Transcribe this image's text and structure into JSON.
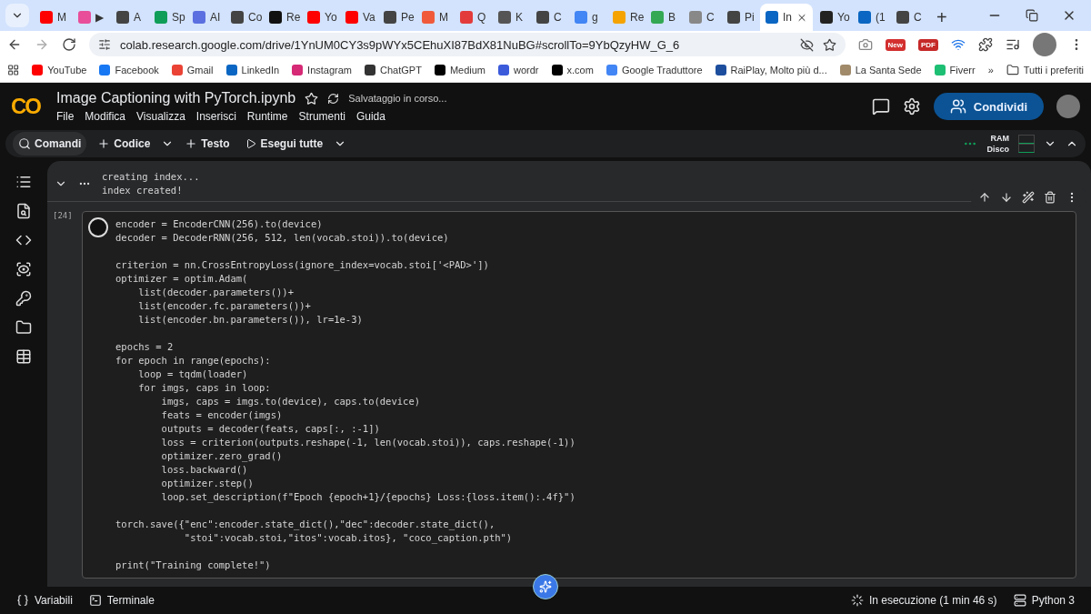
{
  "browser": {
    "tabs": [
      {
        "label": "M",
        "selected": false,
        "color": "#ff0000"
      },
      {
        "label": "▶",
        "selected": false,
        "color": "#e84e9a"
      },
      {
        "label": "A",
        "selected": false,
        "color": "#444444"
      },
      {
        "label": "Sp",
        "selected": false,
        "color": "#0f9d58"
      },
      {
        "label": "AI",
        "selected": false,
        "color": "#5b6fe0"
      },
      {
        "label": "Co",
        "selected": false,
        "color": "#444444"
      },
      {
        "label": "Re",
        "selected": false,
        "color": "#111111"
      },
      {
        "label": "Yo",
        "selected": false,
        "color": "#ff0000"
      },
      {
        "label": "Va",
        "selected": false,
        "color": "#ff0000"
      },
      {
        "label": "Pe",
        "selected": false,
        "color": "#444444"
      },
      {
        "label": "M",
        "selected": false,
        "color": "#f05a3a"
      },
      {
        "label": "Q",
        "selected": false,
        "color": "#e33b3b"
      },
      {
        "label": "K",
        "selected": false,
        "color": "#555555"
      },
      {
        "label": "C",
        "selected": false,
        "color": "#444444"
      },
      {
        "label": "g",
        "selected": false,
        "color": "#4285f4"
      },
      {
        "label": "Re",
        "selected": false,
        "color": "#f4a300"
      },
      {
        "label": "B",
        "selected": false,
        "color": "#34a853"
      },
      {
        "label": "C",
        "selected": false,
        "color": "#888888"
      },
      {
        "label": "Pi",
        "selected": false,
        "color": "#444444"
      },
      {
        "label": "In",
        "selected": true,
        "color": "#0a66c2"
      },
      {
        "label": "Yo",
        "selected": false,
        "color": "#222222"
      },
      {
        "label": "(1",
        "selected": false,
        "color": "#0a66c2"
      },
      {
        "label": "C",
        "selected": false,
        "color": "#444444"
      }
    ],
    "new_tab": "+",
    "url": "colab.research.google.com/drive/1YnUM0CY3s9pWYx5CEhuXI87BdX81NuBG#scrollTo=9YbQzyHW_G_6",
    "extension_badges": [
      {
        "label": "New",
        "color": "#d32f2f"
      },
      {
        "label": "PDF",
        "color": "#c62828"
      }
    ],
    "bookmarks": [
      {
        "label": "YouTube",
        "color": "#ff0000"
      },
      {
        "label": "Facebook",
        "color": "#1877f2"
      },
      {
        "label": "Gmail",
        "color": "#ea4335"
      },
      {
        "label": "LinkedIn",
        "color": "#0a66c2"
      },
      {
        "label": "Instagram",
        "color": "#d62976"
      },
      {
        "label": "ChatGPT",
        "color": "#333333"
      },
      {
        "label": "Medium",
        "color": "#000000"
      },
      {
        "label": "wordr",
        "color": "#3b5bdb"
      },
      {
        "label": "x.com",
        "color": "#000000"
      },
      {
        "label": "Google Traduttore",
        "color": "#4285f4"
      },
      {
        "label": "RaiPlay, Molto più d...",
        "color": "#1d4e9e"
      },
      {
        "label": "La Santa Sede",
        "color": "#a08a6a"
      },
      {
        "label": "Fiverr",
        "color": "#1dbf73"
      }
    ],
    "more": "»",
    "all_bookmarks": "Tutti i preferiti"
  },
  "colab": {
    "logo": "CO",
    "title": "Image Captioning with PyTorch.ipynb",
    "save_status": "Salvataggio in corso...",
    "menu": [
      "File",
      "Modifica",
      "Visualizza",
      "Inserisci",
      "Runtime",
      "Strumenti",
      "Guida"
    ],
    "share_button": "Condividi",
    "toolbar": {
      "commands": "Comandi",
      "add_code": "Codice",
      "add_text": "Testo",
      "run_all": "Esegui tutte",
      "ram": "RAM",
      "disk": "Disco"
    },
    "output_cell": {
      "lines": [
        "creating index...",
        "index created!"
      ]
    },
    "code_cell": {
      "count": "[24]",
      "blocks": [
        [
          "encoder = EncoderCNN(256).to(device)",
          "decoder = DecoderRNN(256, 512, len(vocab.stoi)).to(device)"
        ],
        [
          "criterion = nn.CrossEntropyLoss(ignore_index=vocab.stoi['<PAD>'])",
          "optimizer = optim.Adam(",
          "    list(decoder.parameters())+",
          "    list(encoder.fc.parameters())+",
          "    list(encoder.bn.parameters()), lr=1e-3)"
        ],
        [
          "epochs = 2",
          "for epoch in range(epochs):",
          "    loop = tqdm(loader)",
          "    for imgs, caps in loop:",
          "        imgs, caps = imgs.to(device), caps.to(device)",
          "        feats = encoder(imgs)",
          "        outputs = decoder(feats, caps[:, :-1])",
          "        loss = criterion(outputs.reshape(-1, len(vocab.stoi)), caps.reshape(-1))",
          "        optimizer.zero_grad()",
          "        loss.backward()",
          "        optimizer.step()",
          "        loop.set_description(f\"Epoch {epoch+1}/{epochs} Loss:{loss.item():.4f}\")"
        ],
        [
          "torch.save({\"enc\":encoder.state_dict(),\"dec\":decoder.state_dict(),",
          "            \"stoi\":vocab.stoi,\"itos\":vocab.itos}, \"coco_caption.pth\")"
        ],
        [
          "print(\"Training complete!\")"
        ]
      ]
    },
    "status_bar": {
      "variables": "Variabili",
      "terminal": "Terminale",
      "running": "In esecuzione (1 min 46 s)",
      "runtime": "Python 3"
    }
  }
}
